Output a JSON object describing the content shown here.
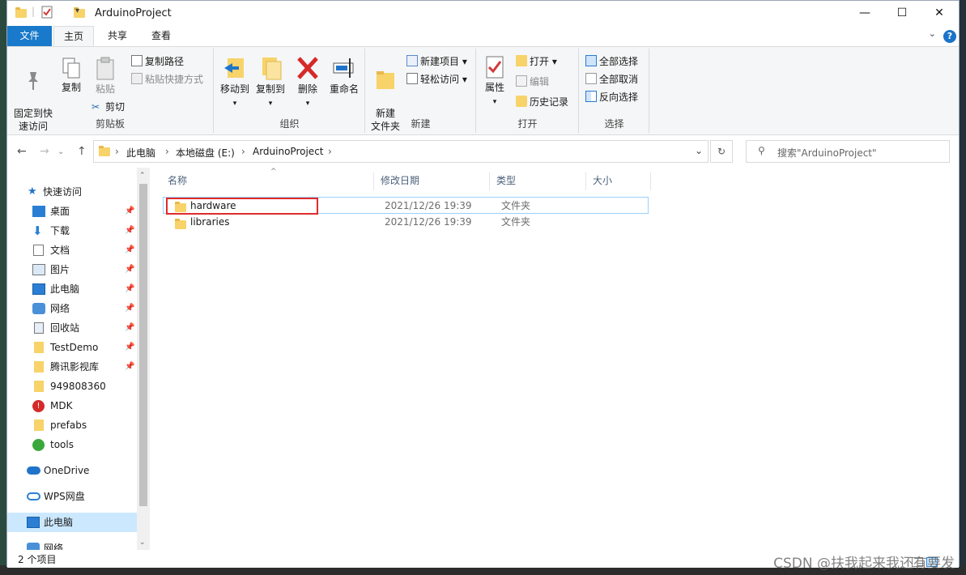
{
  "window": {
    "title": "ArduinoProject",
    "minimize": "—",
    "maximize": "☐",
    "close": "✕"
  },
  "ribbon_tabs": [
    "文件",
    "主页",
    "共享",
    "查看"
  ],
  "ribbon": {
    "clipboard": {
      "label": "剪贴板",
      "pin": "固定到快\n速访问",
      "copy": "复制",
      "paste": "粘贴",
      "copy_path": "复制路径",
      "paste_shortcut": "粘贴快捷方式",
      "cut": "剪切"
    },
    "organize": {
      "label": "组织",
      "move_to": "移动到",
      "copy_to": "复制到",
      "delete": "删除",
      "rename": "重命名"
    },
    "new": {
      "label": "新建",
      "new_folder": "新建\n文件夹",
      "new_item": "新建项目 ▾",
      "easy_access": "轻松访问 ▾"
    },
    "open": {
      "label": "打开",
      "properties": "属性",
      "open": "打开 ▾",
      "edit": "编辑",
      "history": "历史记录"
    },
    "select": {
      "label": "选择",
      "select_all": "全部选择",
      "select_none": "全部取消",
      "invert": "反向选择"
    }
  },
  "address": {
    "segments": [
      "此电脑",
      "本地磁盘 (E:)",
      "ArduinoProject"
    ],
    "separator": "›",
    "search_placeholder": "搜索\"ArduinoProject\""
  },
  "nav_pane": {
    "quick_access": "快速访问",
    "items": [
      {
        "label": "桌面",
        "pinned": true
      },
      {
        "label": "下载",
        "pinned": true
      },
      {
        "label": "文档",
        "pinned": true
      },
      {
        "label": "图片",
        "pinned": true
      },
      {
        "label": "此电脑",
        "pinned": true
      },
      {
        "label": "网络",
        "pinned": true
      },
      {
        "label": "回收站",
        "pinned": true
      },
      {
        "label": "TestDemo",
        "pinned": true
      },
      {
        "label": "腾讯影视库",
        "pinned": true
      },
      {
        "label": "949808360",
        "pinned": false
      },
      {
        "label": "MDK",
        "pinned": false
      },
      {
        "label": "prefabs",
        "pinned": false
      },
      {
        "label": "tools",
        "pinned": false
      }
    ],
    "onedrive": "OneDrive",
    "wps": "WPS网盘",
    "this_pc": "此电脑",
    "network": "网络"
  },
  "columns": [
    "名称",
    "修改日期",
    "类型",
    "大小"
  ],
  "files": [
    {
      "name": "hardware",
      "date": "2021/12/26 19:39",
      "type": "文件夹",
      "size": ""
    },
    {
      "name": "libraries",
      "date": "2021/12/26 19:39",
      "type": "文件夹",
      "size": ""
    }
  ],
  "status": {
    "count": "2 个项目"
  },
  "watermark": "CSDN @扶我起来我还有要发",
  "colors": {
    "accent": "#1979ca",
    "selection": "#cce8ff",
    "highlight_box": "#e02b2b",
    "folder": "#f7d36a"
  }
}
